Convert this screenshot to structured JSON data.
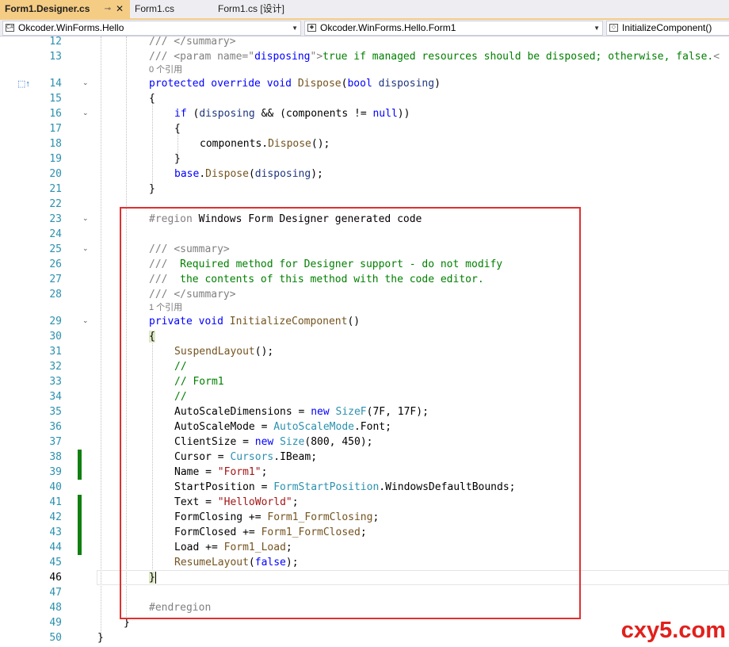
{
  "tabs": [
    {
      "label": "Form1.Designer.cs",
      "pin": "⊸",
      "close": "✕"
    },
    {
      "label": "Form1.cs"
    },
    {
      "label": "Form1.cs [设计]"
    }
  ],
  "nav": {
    "project": "Okcoder.WinForms.Hello",
    "type": "Okcoder.WinForms.Hello.Form1",
    "member": "InitializeComponent()"
  },
  "codelens": {
    "dispose_refs": "0 个引用",
    "init_refs": "1 个引用"
  },
  "line_numbers": [
    "12",
    "13",
    "14",
    "15",
    "16",
    "17",
    "18",
    "19",
    "20",
    "21",
    "22",
    "23",
    "24",
    "25",
    "26",
    "27",
    "28",
    "29",
    "30",
    "31",
    "32",
    "33",
    "34",
    "35",
    "36",
    "37",
    "38",
    "39",
    "40",
    "41",
    "42",
    "43",
    "44",
    "45",
    "46",
    "47",
    "48",
    "49",
    "50"
  ],
  "code": {
    "l12": "/// </summary>",
    "l13a": "/// <param name=\"",
    "l13b": "disposing",
    "l13c": "\">",
    "l13d": "true if managed resources should be disposed; otherwise, false.",
    "l13e": "<",
    "l14kw": "protected override void ",
    "l14m": "Dispose",
    "l14p1": "(",
    "l14kw2": "bool ",
    "l14pa": "disposing",
    "l14p2": ")",
    "l15": "{",
    "l16kw": "if ",
    "l16a": "(",
    "l16pa": "disposing",
    "l16b": " && (components != ",
    "l16kw2": "null",
    "l16c": "))",
    "l17": "{",
    "l18a": "components.",
    "l18m": "Dispose",
    "l18b": "();",
    "l19": "}",
    "l20kw": "base",
    "l20a": ".",
    "l20m": "Dispose",
    "l20b": "(",
    "l20pa": "disposing",
    "l20c": ");",
    "l21": "}",
    "l23pp": "#region ",
    "l23t": "Windows Form Designer generated code",
    "l25a": "/// ",
    "l25b": "<summary>",
    "l26a": "/// ",
    "l26b": " Required method for Designer support - do not modify",
    "l27a": "/// ",
    "l27b": " the contents of this method with the code editor.",
    "l28a": "/// ",
    "l28b": "</summary>",
    "l29kw": "private void ",
    "l29m": "InitializeComponent",
    "l29b": "()",
    "l30": "{",
    "l31m": "SuspendLayout",
    "l31b": "();",
    "l32": "//",
    "l33": "// Form1",
    "l34": "//",
    "l35a": "AutoScaleDimensions = ",
    "l35kw": "new ",
    "l35ty": "SizeF",
    "l35b": "(7F, 17F);",
    "l36a": "AutoScaleMode = ",
    "l36ty": "AutoScaleMode",
    "l36b": ".Font;",
    "l37a": "ClientSize = ",
    "l37kw": "new ",
    "l37ty": "Size",
    "l37b": "(800, 450);",
    "l38a": "Cursor = ",
    "l38ty": "Cursors",
    "l38b": ".IBeam;",
    "l39a": "Name = ",
    "l39st": "\"Form1\"",
    "l39b": ";",
    "l40a": "StartPosition = ",
    "l40ty": "FormStartPosition",
    "l40b": ".WindowsDefaultBounds;",
    "l41a": "Text = ",
    "l41st": "\"HelloWorld\"",
    "l41b": ";",
    "l42a": "FormClosing += ",
    "l42m": "Form1_FormClosing",
    "l42b": ";",
    "l43a": "FormClosed += ",
    "l43m": "Form1_FormClosed",
    "l43b": ";",
    "l44a": "Load += ",
    "l44m": "Form1_Load",
    "l44b": ";",
    "l45m": "ResumeLayout",
    "l45a": "(",
    "l45kw": "false",
    "l45b": ");",
    "l46": "}",
    "l48": "#endregion",
    "l49": "}",
    "l50": "}"
  },
  "gutter_marker": "⬚↑",
  "watermark": "cxy5.com"
}
